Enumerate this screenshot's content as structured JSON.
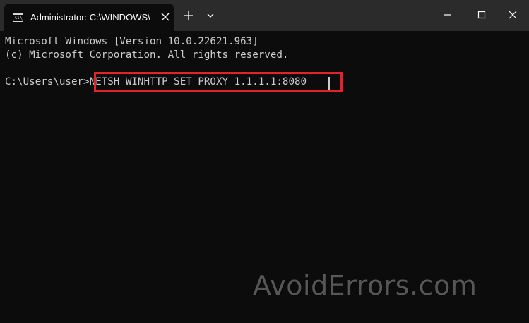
{
  "window": {
    "tab_title": "Administrator: C:\\WINDOWS\\",
    "tab_icon": "command-prompt-icon",
    "new_tab_icon": "plus-icon",
    "dropdown_icon": "chevron-down-icon",
    "close_tab_icon": "close-icon",
    "minimize_icon": "minimize-icon",
    "maximize_icon": "maximize-icon",
    "window_close_icon": "close-icon"
  },
  "terminal": {
    "lines": [
      "Microsoft Windows [Version 10.0.22621.963]",
      "(c) Microsoft Corporation. All rights reserved.",
      "C:\\Users\\user>"
    ],
    "command": "NETSH WINHTTP SET PROXY 1.1.1.1:8080",
    "prompt_icon_text": "C:\\"
  },
  "watermark": {
    "text": "AvoidErrors.com"
  },
  "colors": {
    "background": "#0c0c0c",
    "titlebar": "#2b2b2b",
    "text": "#cccccc",
    "highlight": "#e5212a"
  }
}
